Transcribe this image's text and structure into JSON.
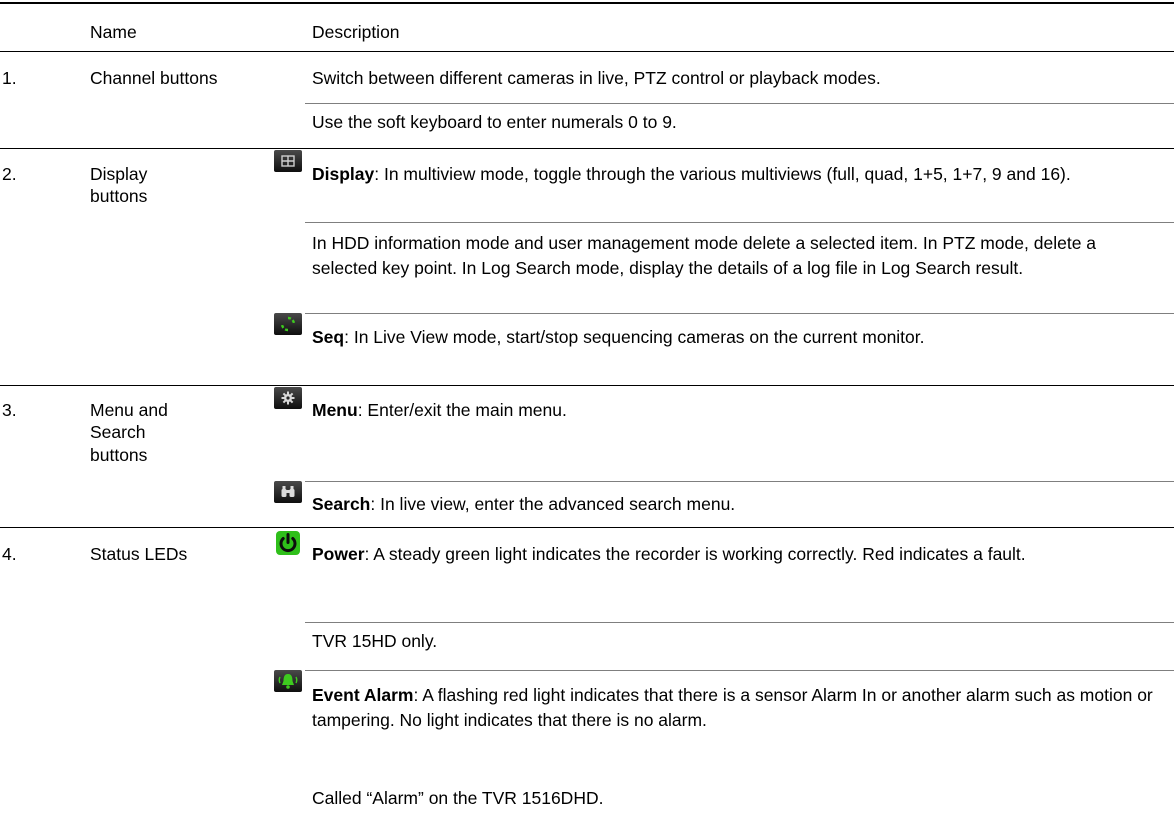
{
  "header": {
    "name": "Name",
    "description": "Description"
  },
  "rows": [
    {
      "num": "1.",
      "name": "Channel buttons",
      "entries": [
        {
          "bold": "",
          "text": "Switch between different cameras in live, PTZ control or playback modes."
        },
        {
          "bold": "",
          "text": "Use the soft keyboard to enter numerals 0 to 9."
        }
      ]
    },
    {
      "num": "2.",
      "name_lines": [
        "Display",
        "buttons"
      ],
      "entries": [
        {
          "icon": "grid-icon",
          "bold": "Display",
          "text": ": In multiview mode, toggle through the various multiviews (full, quad, 1+5, 1+7, 9 and 16)."
        },
        {
          "bold": "",
          "text": "In HDD information mode and user management mode delete a selected item. In PTZ mode, delete a selected key point. In Log Search mode, display the details of a log file in Log Search result."
        },
        {
          "icon": "sequence-icon",
          "bold": "Seq",
          "text": ": In Live View mode, start/stop sequencing cameras on the current monitor."
        }
      ]
    },
    {
      "num": "3.",
      "name_lines": [
        "Menu and",
        "Search",
        "buttons"
      ],
      "entries": [
        {
          "icon": "gear-icon",
          "bold": "Menu",
          "text": ": Enter/exit the main menu."
        },
        {
          "icon": "binoculars-icon",
          "bold": "Search",
          "text": ": In live view, enter the advanced search menu."
        }
      ]
    },
    {
      "num": "4.",
      "name": "Status LEDs",
      "entries": [
        {
          "icon": "power-icon",
          "bold": "Power",
          "text": ": A steady green light indicates the recorder is working correctly. Red indicates a fault."
        },
        {
          "bold": "",
          "text": "TVR 15HD only."
        },
        {
          "icon": "alarm-bell-icon",
          "bold": "Event Alarm",
          "text": ": A flashing red light indicates that there is a sensor Alarm In or another alarm such as motion or tampering. No light indicates that there is no alarm."
        },
        {
          "bold": "",
          "text": "Called “Alarm” on the TVR 1516DHD."
        }
      ]
    }
  ],
  "colors": {
    "icon_green": "#3ecb1f",
    "icon_bg": "#111111",
    "rule": "#000000",
    "rule_light": "#7f7f7f"
  }
}
